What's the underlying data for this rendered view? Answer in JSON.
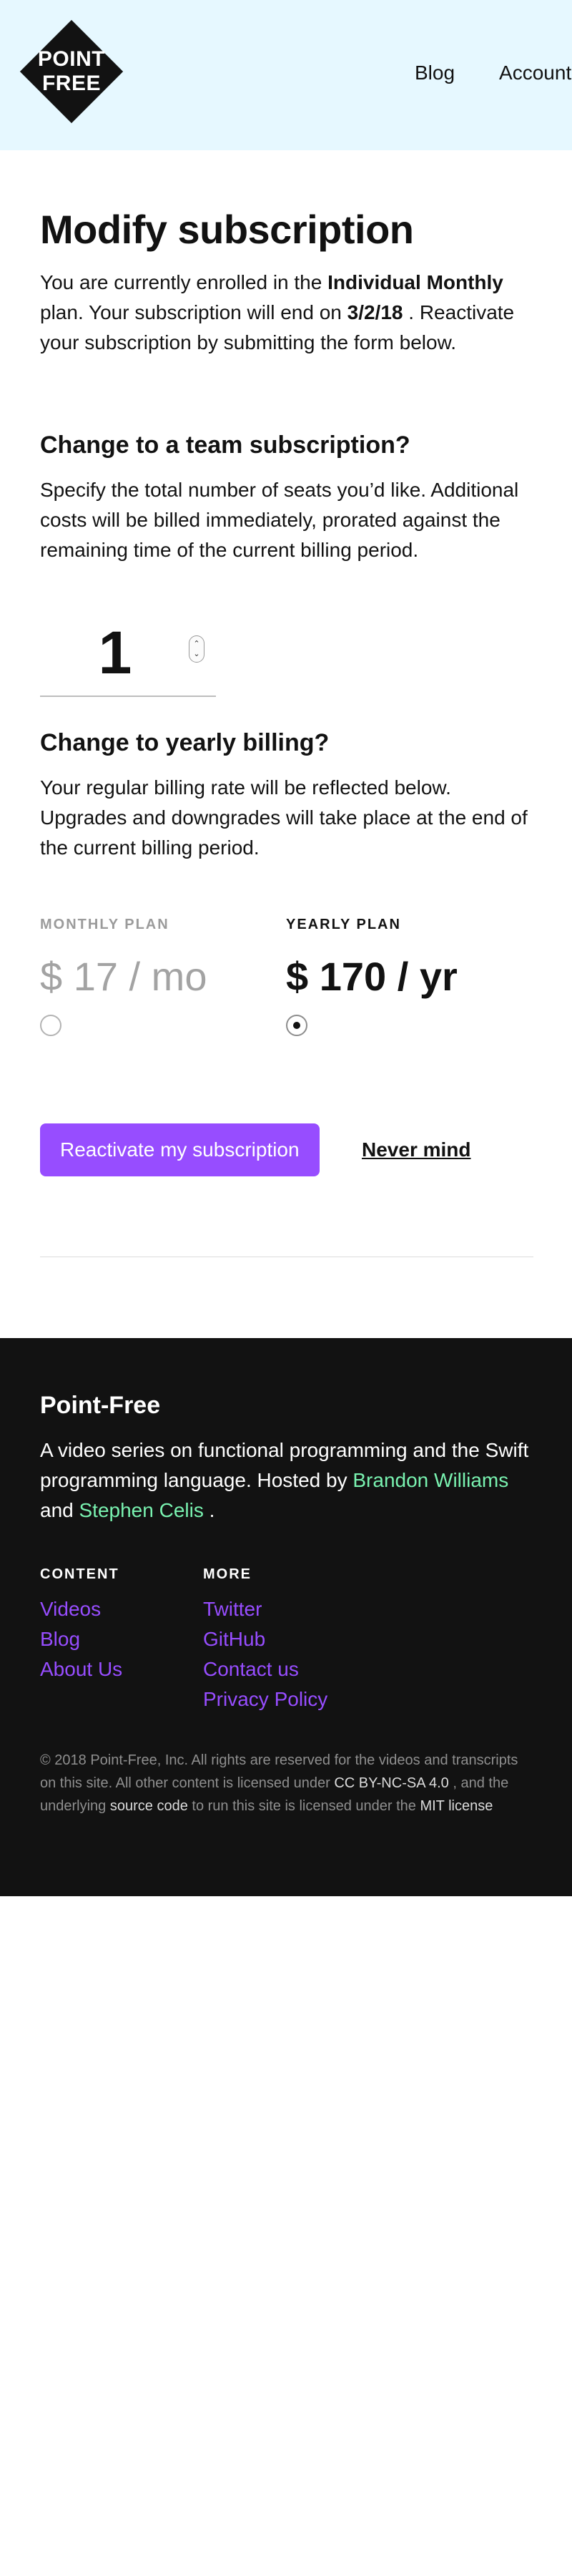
{
  "header": {
    "logo_line1": "POINT",
    "logo_line2": "FREE",
    "nav": {
      "blog": "Blog",
      "account": "Account"
    }
  },
  "main": {
    "title": "Modify subscription",
    "intro": {
      "part1": "You are currently enrolled in the",
      "plan_name": "Individual Monthly",
      "part2": "plan. Your subscription will end on",
      "end_date": "3/2/18",
      "part3": ". Reactivate your subscription by submitting the form below."
    },
    "team": {
      "heading": "Change to a team subscription?",
      "description": "Specify the total number of seats you’d like. Additional costs will be billed immediately, prorated against the remaining time of the current billing period.",
      "seats_value": "1"
    },
    "yearly": {
      "heading": "Change to yearly billing?",
      "description": "Your regular billing rate will be reflected below. Upgrades and downgrades will take place at the end of the current billing period."
    },
    "plans": {
      "monthly": {
        "label": "MONTHLY PLAN",
        "price": "$ 17 / mo",
        "selected": false
      },
      "yearly": {
        "label": "YEARLY PLAN",
        "price": "$ 170 / yr",
        "selected": true
      }
    },
    "actions": {
      "reactivate": "Reactivate my subscription",
      "cancel": "Never mind"
    }
  },
  "footer": {
    "brand": "Point-Free",
    "desc_part1": "A video series on functional programming and the Swift programming language. Hosted by",
    "author1": "Brandon Williams",
    "desc_and": "and",
    "author2": "Stephen Celis",
    "desc_end": ".",
    "content_title": "CONTENT",
    "content_links": [
      "Videos",
      "Blog",
      "About Us"
    ],
    "more_title": "MORE",
    "more_links": [
      "Twitter",
      "GitHub",
      "Contact us",
      "Privacy Policy"
    ],
    "legal": {
      "part1": "© 2018 Point-Free, Inc. All rights are reserved for the videos and transcripts on this site. All other content is licensed under",
      "license1": "CC BY-NC-SA 4.0",
      "part2": ", and the underlying",
      "source": "source code",
      "part3": "to run this site is licensed under the",
      "license2": "MIT license"
    }
  },
  "colors": {
    "header_bg": "#e6f8ff",
    "accent_purple": "#974dff",
    "footer_bg": "#121212",
    "author_green": "#79f2b0"
  }
}
